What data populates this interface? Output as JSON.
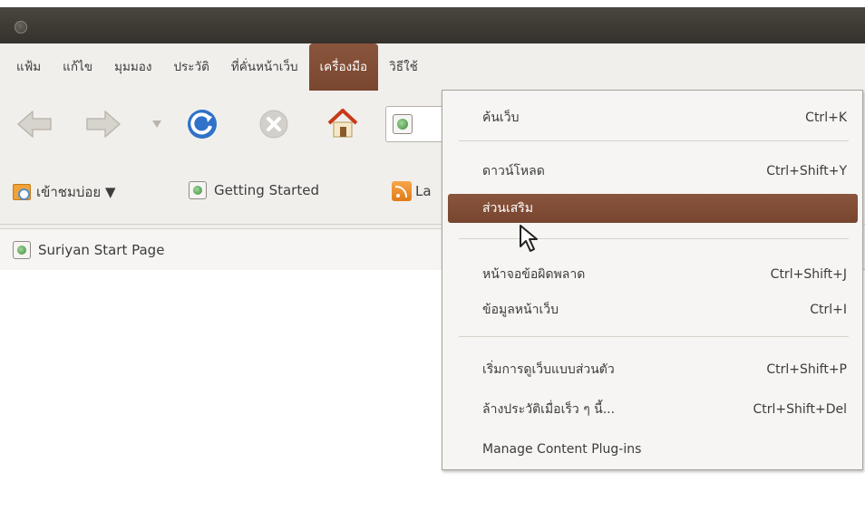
{
  "menubar": {
    "items": [
      "แฟ้ม",
      "แก้ไข",
      "มุมมอง",
      "ประวัติ",
      "ที่คั่นหน้าเว็บ",
      "เครื่องมือ",
      "วิธีใช้"
    ],
    "active_index": 5
  },
  "navbar": {
    "icons": [
      "back-arrow-icon",
      "forward-arrow-icon",
      "history-dropdown-icon",
      "reload-icon",
      "stop-icon",
      "home-icon"
    ]
  },
  "bookmarks": {
    "items": [
      {
        "label": "เข้าชมบ่อย ▼",
        "icon": "smart-folder-icon"
      },
      {
        "label": "Getting Started",
        "icon": "page-icon"
      },
      {
        "label": "La",
        "icon": "rss-icon"
      }
    ]
  },
  "tab": {
    "title": "Suriyan Start Page"
  },
  "tools_menu": {
    "items": [
      {
        "label": "ค้นเว็บ",
        "shortcut": "Ctrl+K"
      },
      {
        "label": "ดาวน์โหลด",
        "shortcut": "Ctrl+Shift+Y"
      },
      {
        "label": "ส่วนเสริม",
        "shortcut": ""
      },
      {
        "label": "หน้าจอข้อผิดพลาด",
        "shortcut": "Ctrl+Shift+J"
      },
      {
        "label": "ข้อมูลหน้าเว็บ",
        "shortcut": "Ctrl+I"
      },
      {
        "label": "เริ่มการดูเว็บแบบส่วนตัว",
        "shortcut": "Ctrl+Shift+P"
      },
      {
        "label": "ล้างประวัติเมื่อเร็ว ๆ นี้...",
        "shortcut": "Ctrl+Shift+Del"
      },
      {
        "label": "Manage Content Plug-ins",
        "shortcut": ""
      }
    ],
    "highlighted_index": 2
  },
  "colors": {
    "titlebar": "#3d3933",
    "chrome": "#f1efec",
    "highlight": "#7f4b34"
  }
}
